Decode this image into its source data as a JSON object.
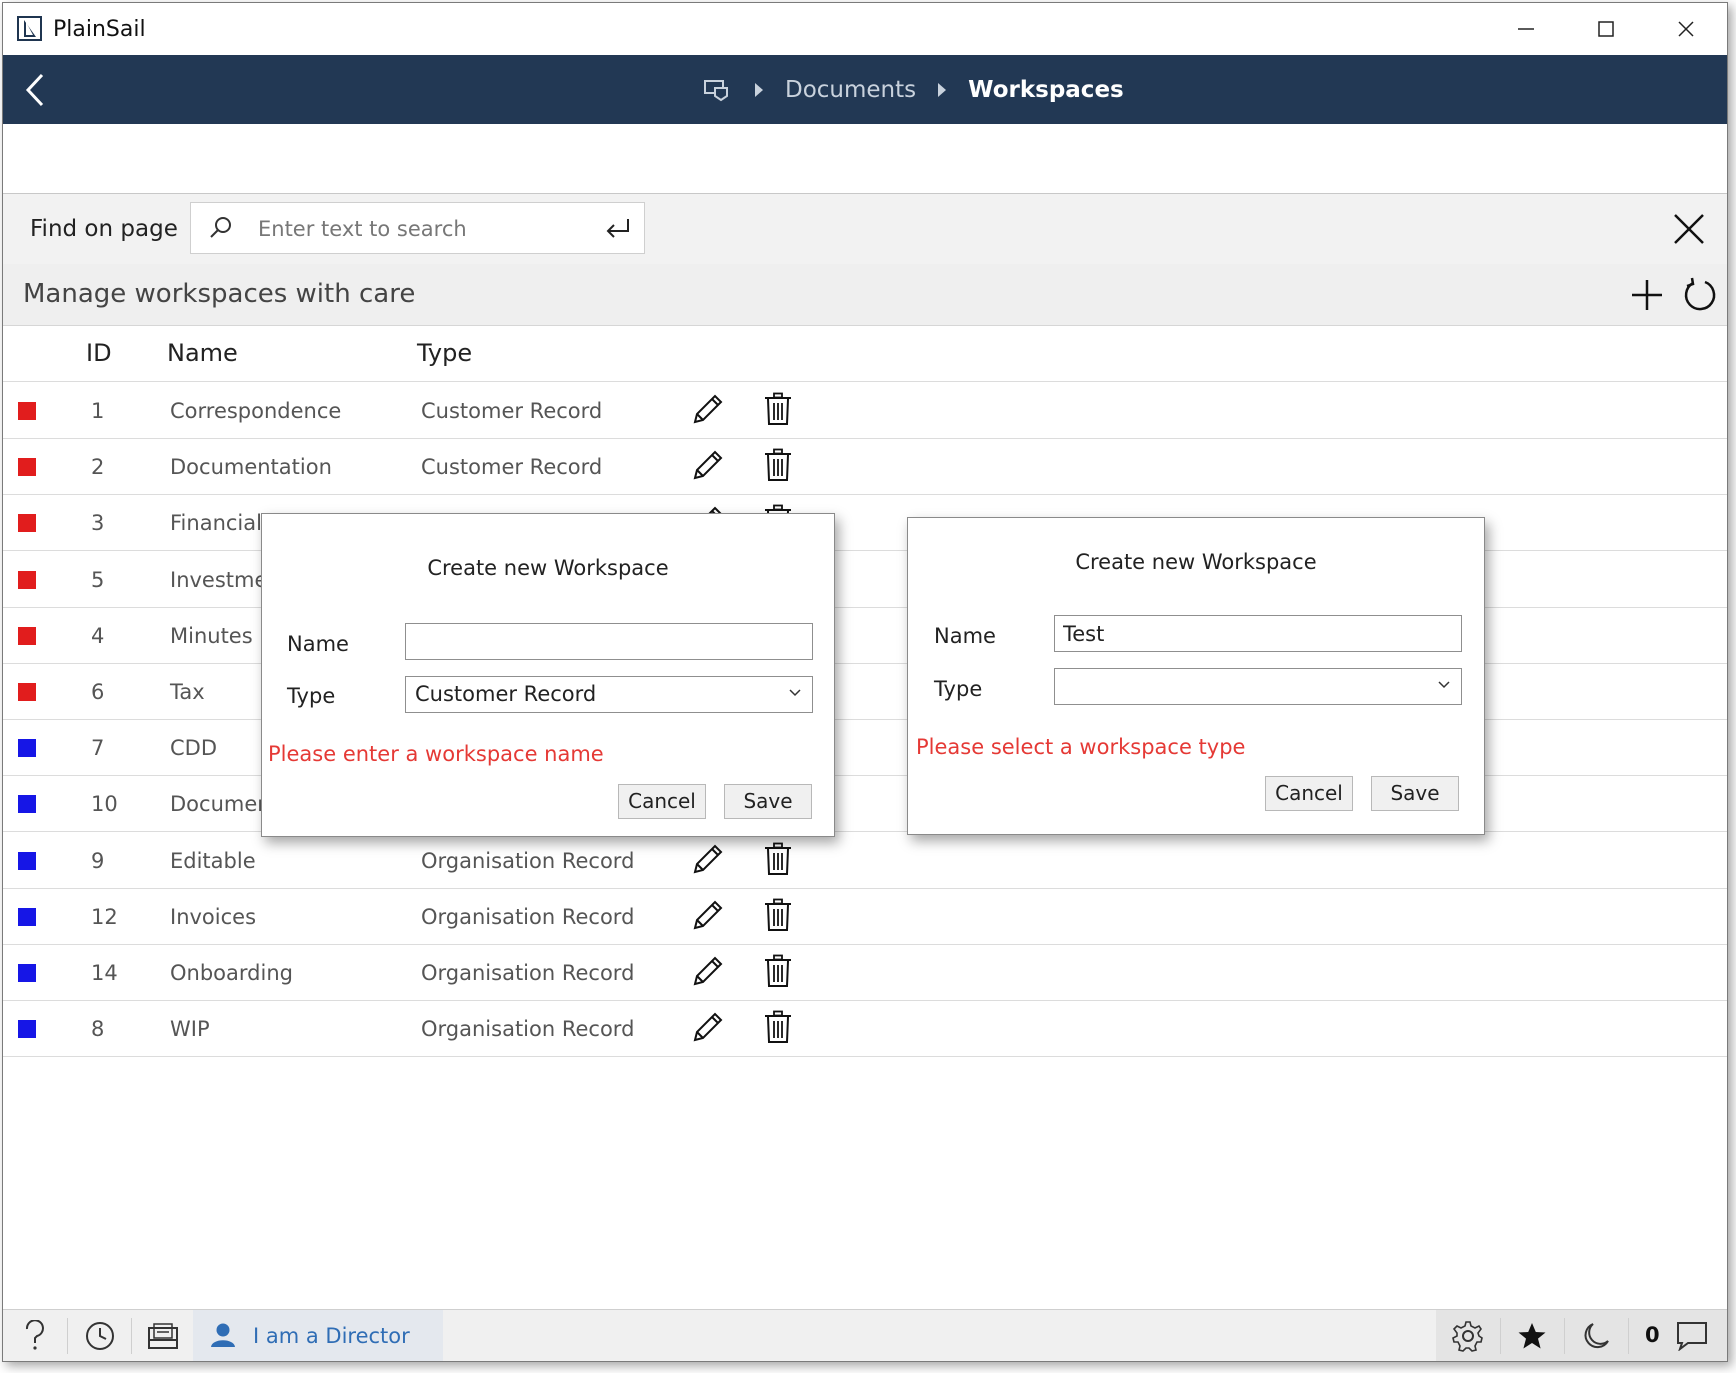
{
  "app": {
    "title": "PlainSail"
  },
  "breadcrumb": {
    "items": [
      "Documents",
      "Workspaces"
    ]
  },
  "find": {
    "label": "Find on page",
    "placeholder": "Enter text to search"
  },
  "page": {
    "title": "Manage workspaces with care"
  },
  "table": {
    "headers": [
      "ID",
      "Name",
      "Type"
    ],
    "rows": [
      {
        "color": "#e11d1d",
        "id": "1",
        "name": "Correspondence",
        "type": "Customer Record"
      },
      {
        "color": "#e11d1d",
        "id": "2",
        "name": "Documentation",
        "type": "Customer Record"
      },
      {
        "color": "#e11d1d",
        "id": "3",
        "name": "Financials",
        "type": ""
      },
      {
        "color": "#e11d1d",
        "id": "5",
        "name": "Investmen",
        "type": ""
      },
      {
        "color": "#e11d1d",
        "id": "4",
        "name": "Minutes",
        "type": ""
      },
      {
        "color": "#e11d1d",
        "id": "6",
        "name": "Tax",
        "type": ""
      },
      {
        "color": "#1616e6",
        "id": "7",
        "name": "CDD",
        "type": ""
      },
      {
        "color": "#1616e6",
        "id": "10",
        "name": "Documen",
        "type": ""
      },
      {
        "color": "#1616e6",
        "id": "9",
        "name": "Editable",
        "type": "Organisation Record"
      },
      {
        "color": "#1616e6",
        "id": "12",
        "name": "Invoices",
        "type": "Organisation Record"
      },
      {
        "color": "#1616e6",
        "id": "14",
        "name": "Onboarding",
        "type": "Organisation Record"
      },
      {
        "color": "#1616e6",
        "id": "8",
        "name": "WIP",
        "type": "Organisation Record"
      }
    ]
  },
  "dialog_left": {
    "title": "Create new Workspace",
    "name_label": "Name",
    "name_value": "",
    "type_label": "Type",
    "type_value": "Customer Record",
    "error": "Please enter a workspace name",
    "cancel": "Cancel",
    "save": "Save"
  },
  "dialog_right": {
    "title": "Create new Workspace",
    "name_label": "Name",
    "name_value": "Test",
    "type_label": "Type",
    "type_value": "",
    "error": "Please select a workspace type",
    "cancel": "Cancel",
    "save": "Save"
  },
  "statusbar": {
    "user_label": "I am a Director",
    "notification_count": "0"
  },
  "icons": [
    "app-logo-icon",
    "minimize-icon",
    "maximize-icon",
    "close-icon",
    "back-arrow-icon",
    "home-icon",
    "search-icon",
    "enter-icon",
    "add-icon",
    "refresh-icon",
    "pencil-icon",
    "trash-icon",
    "help-icon",
    "history-icon",
    "inbox-icon",
    "user-icon",
    "gear-icon",
    "star-icon",
    "moon-icon",
    "chat-icon"
  ]
}
